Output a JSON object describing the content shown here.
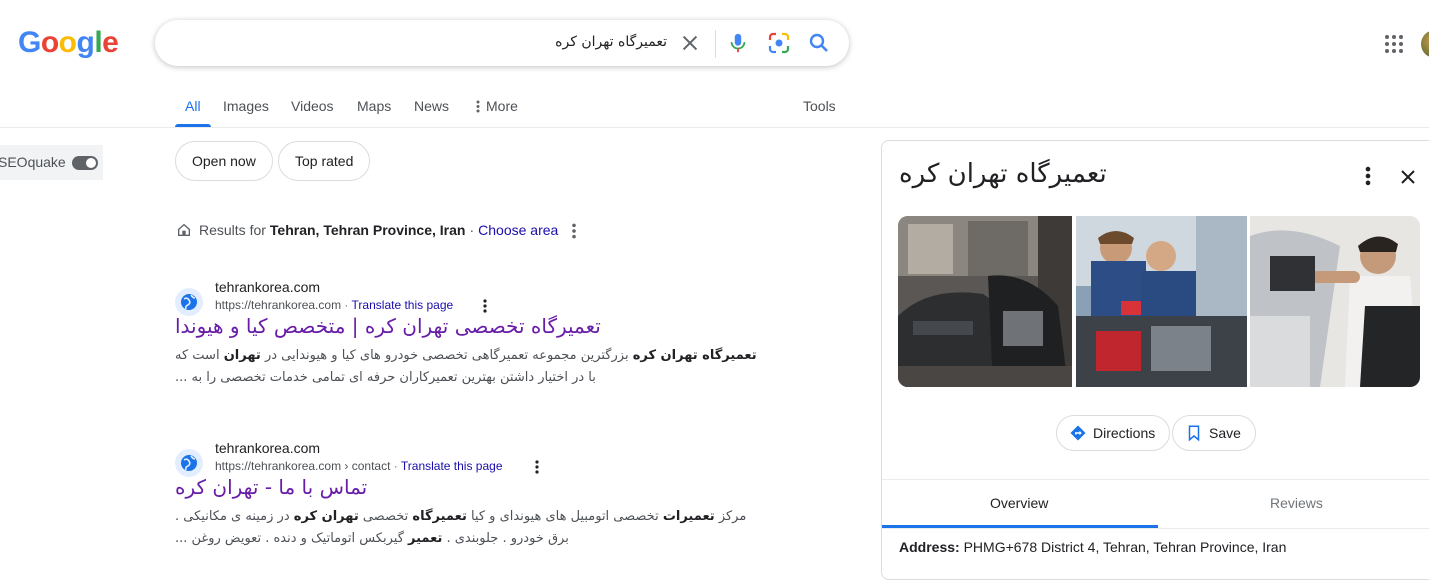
{
  "logo": {
    "text": "Google",
    "letters": [
      "G",
      "o",
      "o",
      "g",
      "l",
      "e"
    ],
    "colors": [
      "#4285f4",
      "#ea4335",
      "#fbbc05",
      "#4285f4",
      "#34a853",
      "#ea4335"
    ]
  },
  "search": {
    "query": "تعمیرگاه تهران کره"
  },
  "tabs": [
    {
      "label": "All",
      "active": true
    },
    {
      "label": "Images"
    },
    {
      "label": "Videos"
    },
    {
      "label": "Maps"
    },
    {
      "label": "News"
    },
    {
      "label": "More"
    }
  ],
  "tools_label": "Tools",
  "seoquake": {
    "label": "SEOquake"
  },
  "chips": [
    {
      "label": "Open now"
    },
    {
      "label": "Top rated"
    }
  ],
  "results_for": {
    "prefix": "Results for",
    "location": "Tehran, Tehran Province, Iran",
    "separator": "·",
    "choose_area": "Choose area"
  },
  "results": [
    {
      "site": "tehrankorea.com",
      "url": "https://tehrankorea.com",
      "translate": "Translate this page",
      "title": "تعمیرگاه تخصصی تهران کره | متخصص کیا و هیوندا",
      "snippet_line1_html": "<b>تعمیرگاه تهران کره</b> بزرگترین مجموعه تعمیرگاهی تخصصی خودرو های کیا و هیوندایی در <b>تهران</b> است که",
      "snippet_line2": "با در اختیار داشتن بهترین تعمیرکاران حرفه ای تمامی خدمات تخصصی را به ..."
    },
    {
      "site": "tehrankorea.com",
      "url": "https://tehrankorea.com › contact",
      "translate": "Translate this page",
      "title": "تماس با ما - تهران کره",
      "snippet_line1_html": "مرکز <b>تعمیرات</b> تخصصی اتومبیل های هیوندای و کیا <b>تعمیرگاه</b> تخصصی <b>تهران کره</b> در زمینه ی مکانیکی .",
      "snippet_line2_html": "برق خودرو . جلوبندی . <b>تعمیر</b> گیربکس اتوماتیک و دنده . تعویض روغن ..."
    }
  ],
  "knowledge_panel": {
    "title": "تعمیرگاه تهران کره",
    "directions_label": "Directions",
    "save_label": "Save",
    "tabs": [
      {
        "label": "Overview",
        "active": true
      },
      {
        "label": "Reviews"
      }
    ],
    "address_label": "Address:",
    "address_value": "PHMG+678 District 4, Tehran, Tehran Province, Iran"
  },
  "colors": {
    "accent": "#1a73e8",
    "visited_link": "#681da8",
    "link": "#1a0dab"
  }
}
